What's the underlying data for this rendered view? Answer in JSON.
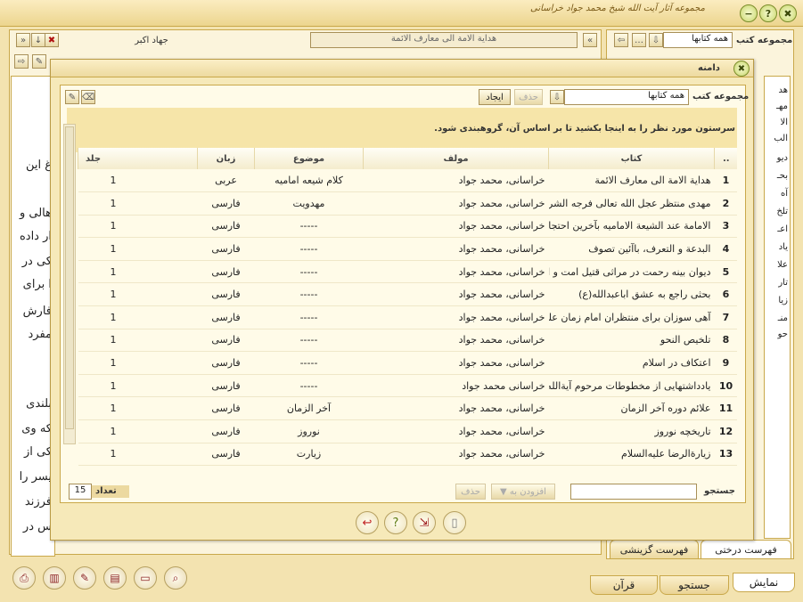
{
  "app": {
    "logo": "مجموعه آثار آیت الله شیخ محمد جواد خراسانی",
    "top_buttons": {
      "close": "✖",
      "help": "?",
      "minimize": "−"
    }
  },
  "left_panel": {
    "book_title": "هداية الامة الى معارف الائمة",
    "section": "جهاد اكبر",
    "reading_lines": [
      "غ اين",
      "هالی و",
      "ار داده",
      "کی در",
      "ا برای",
      "فارش",
      "مفرد",
      "بلندی",
      "که وی",
      "کی از",
      "یسر را",
      "فرزند",
      "س در"
    ]
  },
  "right_panel": {
    "collection_label": "مجموعه كتب",
    "collection_value": "همه كتابها",
    "tree_items": [
      "هد",
      "مهـ",
      "الا",
      "الب",
      "دیو",
      "بحـ",
      "آه",
      "تلخ",
      "اعـ",
      "یاد",
      "علا",
      "تار",
      "زیا",
      "منـ",
      "حو"
    ],
    "tabs": {
      "tree": "فهرست درختی",
      "selective": "فهرست گزینشی"
    }
  },
  "bottom_tabs": {
    "show": "نمایش",
    "search": "جستجو",
    "quran": "قرآن"
  },
  "dialog": {
    "title": "دامنه",
    "collection_label": "مجموعه كتب",
    "collection_value": "همه كتابها",
    "delete_label": "حذف",
    "create_label": "ايجاد",
    "hint": "سرستون مورد نظر را به اينجا بكشيد تا بر اساس آن، گروهبندی شود.",
    "columns": {
      "row": "..",
      "book": "كتاب",
      "author": "مولف",
      "subject": "موضوع",
      "lang": "زبان",
      "vol": "جلد"
    },
    "rows": [
      {
        "n": "1",
        "book": "هداية الامة الى معارف الائمة",
        "author": "خراسانی، محمد جواد",
        "subject": "كلام شيعه اماميه",
        "lang": "عربی",
        "vol": "1"
      },
      {
        "n": "2",
        "book": "مهدی منتظر عجل الله تعالى فرجه الشريف",
        "author": "خراسانی، محمد جواد",
        "subject": "مهدويت",
        "lang": "فارسی",
        "vol": "1"
      },
      {
        "n": "3",
        "book": "الامامة عند الشيعة الاماميه بآخرين احتجاج و آخرين",
        "author": "خراسانی، محمد جواد",
        "subject": "-----",
        "lang": "فارسی",
        "vol": "1"
      },
      {
        "n": "4",
        "book": "البدعة و التعرف، باآئين تصوف",
        "author": "خراسانی، محمد جواد",
        "subject": "-----",
        "lang": "فارسی",
        "vol": "1"
      },
      {
        "n": "5",
        "book": "ديوان بينه رحمت در مراثی قتيل امت و اهلبيت",
        "author": "خراسانی، محمد جواد",
        "subject": "-----",
        "lang": "فارسی",
        "vol": "1"
      },
      {
        "n": "6",
        "book": "بحثی راجع به عشق اباعبدالله(ع)",
        "author": "خراسانی، محمد جواد",
        "subject": "-----",
        "lang": "فارسی",
        "vol": "1"
      },
      {
        "n": "7",
        "book": "آهی سوزان برای منتظران امام زمان عليه السلام",
        "author": "خراسانی، محمد جواد",
        "subject": "-----",
        "lang": "فارسی",
        "vol": "1"
      },
      {
        "n": "8",
        "book": "تلخيص النحو",
        "author": "خراسانی، محمد جواد",
        "subject": "-----",
        "lang": "فارسی",
        "vol": "1"
      },
      {
        "n": "9",
        "book": "اعتكاف در اسلام",
        "author": "خراسانی، محمد جواد",
        "subject": "-----",
        "lang": "فارسی",
        "vol": "1"
      },
      {
        "n": "10",
        "book": "يادداشتهايی از مخطوطات مرحوم آيةالله العظمی",
        "author": "خراسانی محمد جواد",
        "subject": "-----",
        "lang": "فارسی",
        "vol": "1"
      },
      {
        "n": "11",
        "book": "علائم دوره آخر الزمان",
        "author": "خراسانی، محمد جواد",
        "subject": "آخر الزمان",
        "lang": "فارسی",
        "vol": "1"
      },
      {
        "n": "12",
        "book": "تاريخچه نوروز",
        "author": "خراسانی، محمد جواد",
        "subject": "نوروز",
        "lang": "فارسی",
        "vol": "1"
      },
      {
        "n": "13",
        "book": "زيارةالرضا عليه‌السلام",
        "author": "خراسانی، محمد جواد",
        "subject": "زيارت",
        "lang": "فارسی",
        "vol": "1"
      }
    ],
    "search_label": "جستجو",
    "add_to_label": "افزودن به",
    "remove_label": "حذف",
    "count_label": "تعداد",
    "count_value": "15"
  }
}
